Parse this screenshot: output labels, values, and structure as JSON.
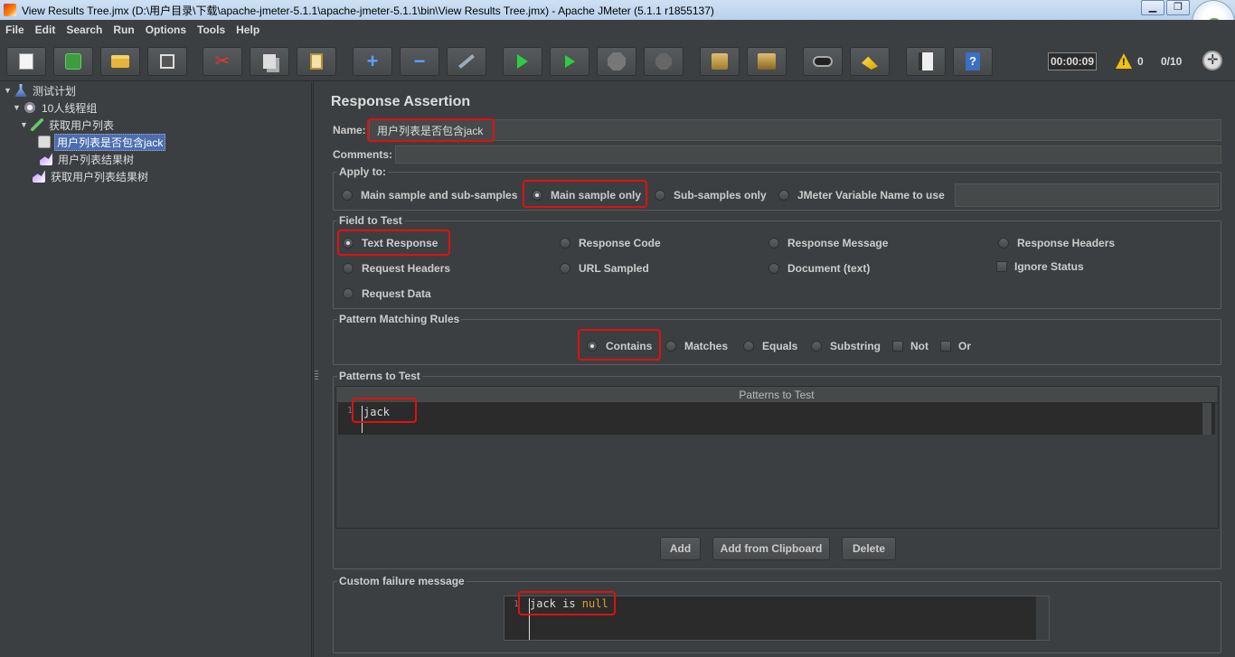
{
  "window": {
    "title": "View Results Tree.jmx (D:\\用户目录\\下载\\apache-jmeter-5.1.1\\apache-jmeter-5.1.1\\bin\\View Results Tree.jmx) - Apache JMeter (5.1.1 r1855137)",
    "minimize_glyph": "▁",
    "maximize_glyph": "❐"
  },
  "menu": [
    "File",
    "Edit",
    "Search",
    "Run",
    "Options",
    "Tools",
    "Help"
  ],
  "toolbar": {
    "cut_glyph": "✂",
    "plus_glyph": "+",
    "minus_glyph": "−",
    "help_glyph": "?",
    "timer": "00:00:09",
    "warn_count": "0",
    "threads": "0/10"
  },
  "tree": {
    "items": [
      {
        "label": "测试计划",
        "toggle": "▼"
      },
      {
        "label": "10人线程组",
        "toggle": "▼"
      },
      {
        "label": "获取用户列表",
        "toggle": "▼"
      },
      {
        "label": "用户列表是否包含jack",
        "toggle": ""
      },
      {
        "label": "用户列表结果树",
        "toggle": ""
      },
      {
        "label": "获取用户列表结果树",
        "toggle": ""
      }
    ]
  },
  "panel": {
    "title": "Response Assertion",
    "name_label": "Name:",
    "name_value": "用户列表是否包含jack",
    "comments_label": "Comments:",
    "apply_to": {
      "title": "Apply to:",
      "options": [
        "Main sample and sub-samples",
        "Main sample only",
        "Sub-samples only",
        "JMeter Variable Name to use"
      ],
      "selected": "Main sample only"
    },
    "field_to_test": {
      "title": "Field to Test",
      "options": [
        "Text Response",
        "Response Code",
        "Response Message",
        "Response Headers",
        "Request Headers",
        "URL Sampled",
        "Document (text)",
        "Request Data"
      ],
      "ignore_status": "Ignore Status",
      "selected": "Text Response"
    },
    "pattern_rules": {
      "title": "Pattern Matching Rules",
      "options": [
        "Contains",
        "Matches",
        "Equals",
        "Substring"
      ],
      "checks": [
        "Not",
        "Or"
      ],
      "selected": "Contains"
    },
    "patterns": {
      "title": "Patterns to Test",
      "column_header": "Patterns to Test",
      "line_no": "1",
      "value": "jack",
      "buttons": [
        "Add",
        "Add from Clipboard",
        "Delete"
      ]
    },
    "failure": {
      "title": "Custom failure message",
      "line_no": "1",
      "text": "jack is ",
      "keyword": "null"
    }
  }
}
